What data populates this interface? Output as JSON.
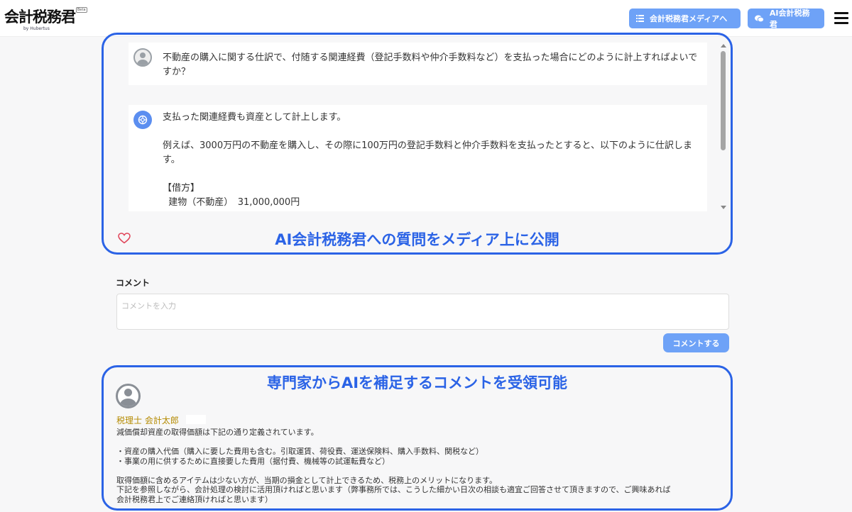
{
  "header": {
    "logo_text": "会計税務君",
    "logo_badge": "Beta",
    "logo_sub": "by Hubertus",
    "media_button": "会計税務君メディアへ",
    "ai_button": "AI会計税務君",
    "icons": {
      "media": "list-icon",
      "ai": "chat-bubbles-icon",
      "menu": "hamburger-menu-icon"
    }
  },
  "chat": {
    "question": "不動産の購入に関する仕訳で、付随する関連経費（登記手数料や仲介手数料など）を支払った場合にどのように計上すればよいですか？",
    "answer": "支払った関連経費も資産として計上します。\n\n例えば、3000万円の不動産を購入し、その際に100万円の登記手数料と仲介手数料を支払ったとすると、以下のように仕訳します。\n\n【借方】\n  建物（不動産）　31,000,000円"
  },
  "callouts": {
    "top": "AI会計税務君への質問をメディア上に公開",
    "bottom": "専門家からAIを補足するコメントを受領可能"
  },
  "comment_form": {
    "label": "コメント",
    "placeholder": "コメントを入力",
    "value": "",
    "submit": "コメントする"
  },
  "expert_comment": {
    "author": "税理士 会計太郎",
    "text": "減価償却資産の取得価額は下記の通り定義されています。\n\n・資産の購入代価（購入に要した費用も含む。引取運賃、荷役費、運送保険料、購入手数料、関税など）\n・事業の用に供するために直接要した費用（据付費、機械等の試運転費など）\n\n取得価額に含めるアイテムは少ない方が、当期の損金として計上できるため、税務上のメリットになります。\n下記を参照しながら、会計処理の検討に活用頂ければと思います（弊事務所では、こうした細かい日次の相談も適宜ご回答させて頂きますので、ご興味あれば\n会計税務君上でご連絡頂ければと思います）"
  },
  "colors": {
    "accent": "#6ea2f7",
    "callout": "#2b63e6",
    "heart": "#e0455a",
    "author": "#b48a00"
  }
}
